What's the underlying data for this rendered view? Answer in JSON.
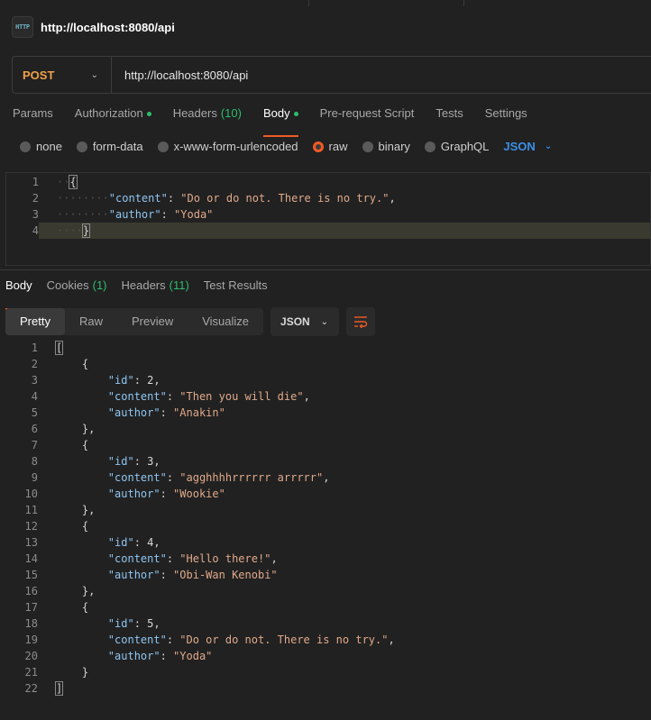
{
  "tab": {
    "title": "http://localhost:8080/api",
    "icon": "http-icon",
    "icon_text": "HTTP"
  },
  "request": {
    "method": "POST",
    "url": "http://localhost:8080/api",
    "tabs": [
      {
        "label": "Params"
      },
      {
        "label": "Authorization"
      },
      {
        "label": "Headers",
        "count": "(10)"
      },
      {
        "label": "Body"
      },
      {
        "label": "Pre-request Script"
      },
      {
        "label": "Tests"
      },
      {
        "label": "Settings"
      }
    ],
    "body_types": [
      "none",
      "form-data",
      "x-www-form-urlencoded",
      "raw",
      "binary",
      "GraphQL"
    ],
    "selected_body_type": "raw",
    "format": "JSON",
    "body_lines": [
      {
        "n": "1",
        "key": "",
        "val": ""
      },
      {
        "n": "2",
        "key": "\"content\"",
        "val": "\"Do or do not. There is no try.\""
      },
      {
        "n": "3",
        "key": "\"author\"",
        "val": "\"Yoda\""
      },
      {
        "n": "4",
        "key": "",
        "val": ""
      }
    ]
  },
  "response": {
    "tabs": [
      {
        "label": "Body"
      },
      {
        "label": "Cookies",
        "count": "(1)"
      },
      {
        "label": "Headers",
        "count": "(11)"
      },
      {
        "label": "Test Results"
      }
    ],
    "views": [
      "Pretty",
      "Raw",
      "Preview",
      "Visualize"
    ],
    "format": "JSON",
    "items": [
      {
        "id": "2",
        "content": "\"Then you will die\"",
        "author": "\"Anakin\""
      },
      {
        "id": "3",
        "content": "\"agghhhhrrrrrr arrrrr\"",
        "author": "\"Wookie\""
      },
      {
        "id": "4",
        "content": "\"Hello there!\"",
        "author": "\"Obi-Wan Kenobi\""
      },
      {
        "id": "5",
        "content": "\"Do or do not. There is no try.\"",
        "author": "\"Yoda\""
      }
    ]
  },
  "colors": {
    "accent": "#ef5b25",
    "method": "#f0a04a",
    "ok": "#2dbd6e",
    "link": "#3c8fe8"
  }
}
